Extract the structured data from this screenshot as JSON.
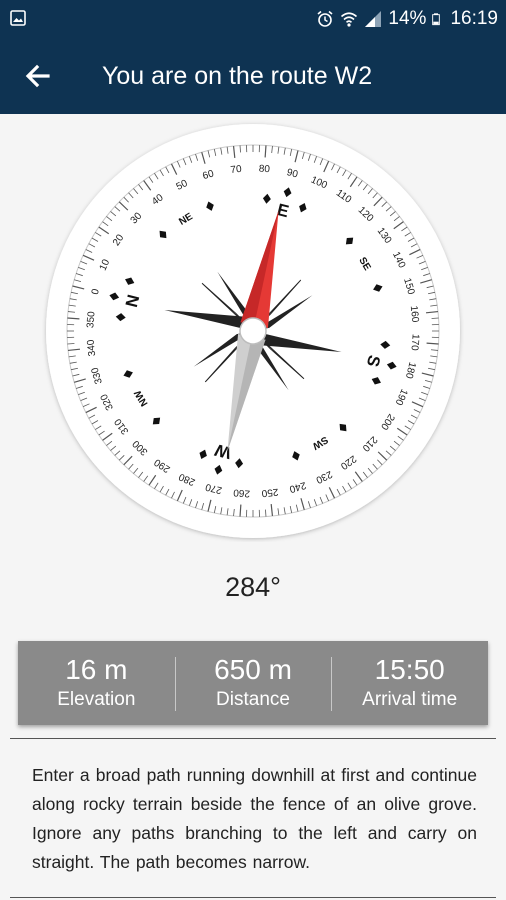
{
  "status_bar": {
    "left_icon": "image-icon",
    "icons": [
      "alarm-icon",
      "wifi-icon",
      "cell-signal-icon"
    ],
    "battery_text": "14%",
    "battery_icon": "battery-icon",
    "time": "16:19",
    "background": "#0e3352"
  },
  "app_bar": {
    "back_icon": "back-arrow-icon",
    "title": "You are on the route W2",
    "background": "#0e3352"
  },
  "compass": {
    "heading": "284°",
    "dial_numbers": [
      "0",
      "10",
      "20",
      "30",
      "40",
      "50",
      "60",
      "70",
      "80",
      "90",
      "100",
      "110",
      "120",
      "130",
      "140",
      "150",
      "160",
      "170",
      "180",
      "190",
      "200",
      "210",
      "220",
      "230",
      "240",
      "250",
      "260",
      "270",
      "280",
      "290",
      "300",
      "310",
      "320",
      "330",
      "340",
      "350"
    ],
    "cardinals": {
      "n": "N",
      "e": "E",
      "s": "S",
      "w": "W"
    },
    "intercardinals": {
      "ne": "NE",
      "se": "SE",
      "sw": "SW",
      "nw": "NW"
    },
    "needle_color": "#e53935"
  },
  "stats": {
    "elevation_value": "16 m",
    "elevation_label": "Elevation",
    "distance_value": "650 m",
    "distance_label": "Distance",
    "arrival_value": "15:50",
    "arrival_label": "Arrival time"
  },
  "description": "Enter a broad path running downhill at first and continue along rocky terrain beside the fence of an olive grove. Ignore any paths branching to the left and carry on straight. The path becomes narrow."
}
